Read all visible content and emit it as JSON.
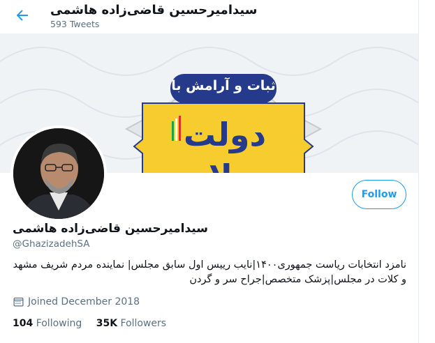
{
  "header": {
    "name": "سیدامیرحسین قاضی‌زاده هاشمی",
    "tweet_count": "593 Tweets"
  },
  "banner": {
    "top_text": "ثبات و آرامش با",
    "main_text": "دولت سلام",
    "colors": {
      "blue": "#263a8c",
      "yellow": "#f7cc2f",
      "red": "#e52c2c",
      "green": "#1aa24a"
    }
  },
  "profile": {
    "name": "سیدامیرحسین قاضی‌زاده هاشمی",
    "handle": "@GhazizadehSA",
    "bio": "نامزد انتخابات ریاست جمهوری۱۴۰۰|نایب رییس اول سابق مجلس| نماینده مردم شریف مشهد و کلات در مجلس|پزشک متخصص|جراح سر و گردن",
    "joined": "Joined December 2018",
    "following_count": "104",
    "following_label": "Following",
    "followers_count": "35K",
    "followers_label": "Followers"
  },
  "follow_button": "Follow",
  "icons": {
    "back": "back-arrow-icon",
    "calendar": "calendar-icon"
  },
  "accent": "#1d9bf0"
}
